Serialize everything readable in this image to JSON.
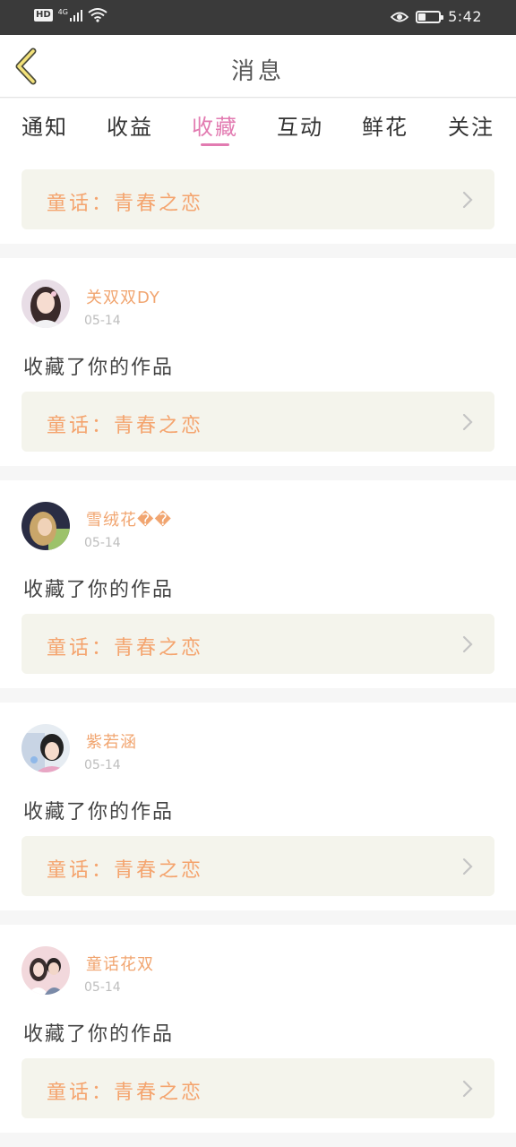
{
  "status_bar": {
    "hd": "HD",
    "network": "4G",
    "time": "5:42",
    "battery_level": 0.35
  },
  "header": {
    "title": "消息"
  },
  "tabs": [
    {
      "label": "通知",
      "active": false
    },
    {
      "label": "收益",
      "active": false
    },
    {
      "label": "收藏",
      "active": true
    },
    {
      "label": "互动",
      "active": false
    },
    {
      "label": "鲜花",
      "active": false
    },
    {
      "label": "关注",
      "active": false
    }
  ],
  "colors": {
    "accent": "#e27bb1",
    "name_color": "#f1a570",
    "work_title_color": "#f4a46e",
    "card_link_bg": "#f4f4ec"
  },
  "top_item": {
    "work_title": "童话：青春之恋"
  },
  "messages": [
    {
      "username": "关双双DY",
      "date": "05-14",
      "action": "收藏了你的作品",
      "work_title": "童话：青春之恋",
      "avatar": "avatar-girl-icon"
    },
    {
      "username": "雪绒花��",
      "date": "05-14",
      "action": "收藏了你的作品",
      "work_title": "童话：青春之恋",
      "avatar": "avatar-child-icon"
    },
    {
      "username": "紫若涵",
      "date": "05-14",
      "action": "收藏了你的作品",
      "work_title": "童话：青春之恋",
      "avatar": "avatar-costume-icon"
    },
    {
      "username": "童话花双",
      "date": "05-14",
      "action": "收藏了你的作品",
      "work_title": "童话：青春之恋",
      "avatar": "avatar-couple-icon"
    }
  ]
}
